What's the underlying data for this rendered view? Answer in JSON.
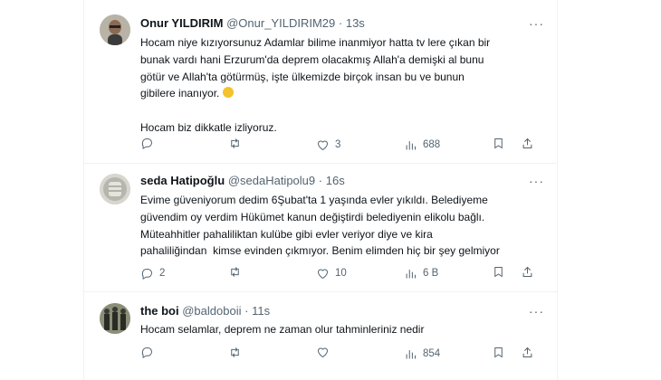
{
  "tweets": [
    {
      "name": "Onur YILDIRIM",
      "handle": "@Onur_YILDIRIM29",
      "dot": "·",
      "time": "13s",
      "more": "···",
      "text1": "Hocam niye kızıyorsunuz Adamlar bilime inanmiyor hatta tv lere çıkan bir\nbunak vardı hani Erzurum'da deprem olacakmış Allah'a demişki al bunu\ngötür ve Allah'ta götürmüş, işte ülkemizde birçok insan bu ve bunun\ngibilere inanıyor.",
      "emoji": "😅",
      "text2": "\n\nHocam biz dikkatle izliyoruz.",
      "replies": "",
      "retweets": "",
      "likes": "3",
      "views": "688"
    },
    {
      "name": "seda Hatipoğlu",
      "handle": "@sedaHatipolu9",
      "dot": "·",
      "time": "16s",
      "more": "···",
      "text1": "Evime güveniyorum dedim 6Şubat'ta 1 yaşında evler yıkıldı. Belediyeme\ngüvendim oy verdim Hükümet kanun değiştirdi belediyenin elikolu bağlı.\nMüteahhitler pahaliliktan kulübe gibi evler veriyor diye ve kira\npahaliliğindan  kimse evinden çıkmıyor. Benim elimden hiç bir şey gelmiyor",
      "emoji": "",
      "text2": "",
      "replies": "2",
      "retweets": "",
      "likes": "10",
      "views": "6 B"
    },
    {
      "name": "the boi",
      "handle": "@baldoboii",
      "dot": "·",
      "time": "11s",
      "more": "···",
      "text1": "Hocam selamlar, deprem ne zaman olur tahminleriniz nedir",
      "emoji": "",
      "text2": "",
      "replies": "",
      "retweets": "",
      "likes": "",
      "views": "854"
    }
  ],
  "icons": {
    "reply": "reply-icon",
    "retweet": "retweet-icon",
    "like": "heart-icon",
    "views": "views-icon",
    "bookmark": "bookmark-icon",
    "share": "share-icon"
  }
}
